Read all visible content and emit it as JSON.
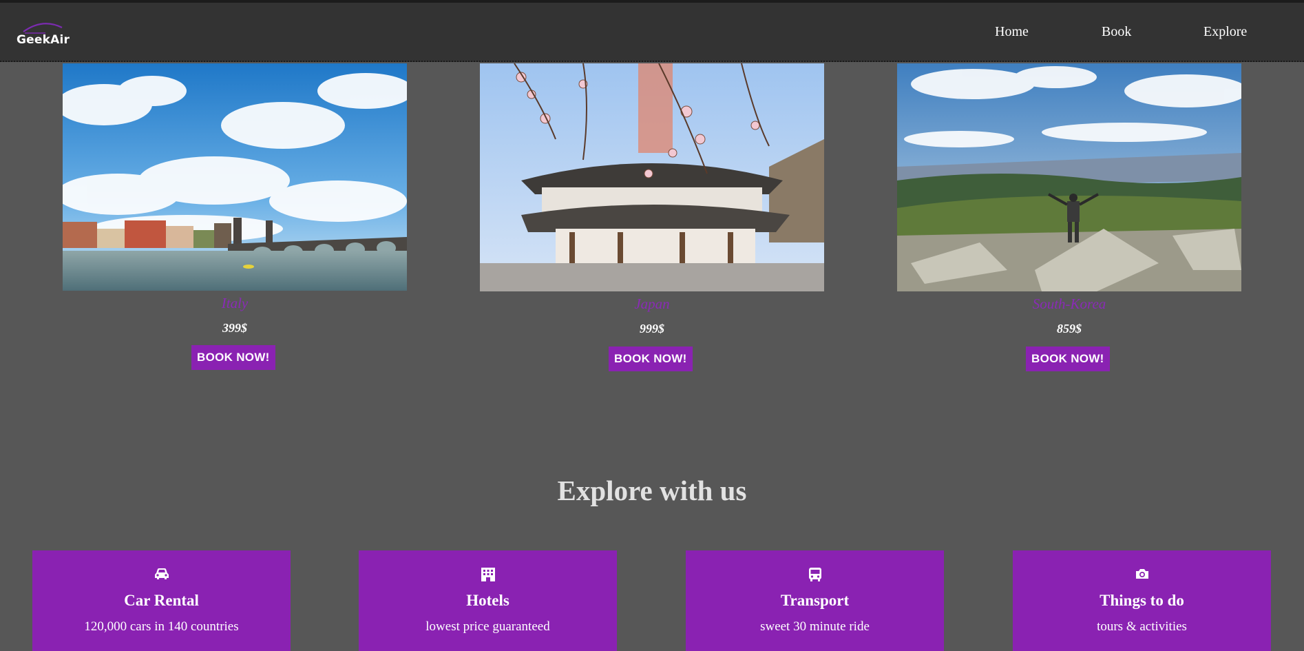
{
  "brand": {
    "name": "GeekAir"
  },
  "nav": {
    "items": [
      "Home",
      "Book",
      "Explore"
    ]
  },
  "destinations": [
    {
      "name": "Italy",
      "price": "399$",
      "button": "BOOK NOW!"
    },
    {
      "name": "Japan",
      "price": "999$",
      "button": "BOOK NOW!"
    },
    {
      "name": "South-Korea",
      "price": "859$",
      "button": "BOOK NOW!"
    }
  ],
  "explore": {
    "title": "Explore with us",
    "cards": [
      {
        "icon": "car-icon",
        "title": "Car Rental",
        "subtitle": "120,000 cars in 140 countries"
      },
      {
        "icon": "building-icon",
        "title": "Hotels",
        "subtitle": "lowest price guaranteed"
      },
      {
        "icon": "bus-icon",
        "title": "Transport",
        "subtitle": "sweet 30 minute ride"
      },
      {
        "icon": "camera-icon",
        "title": "Things to do",
        "subtitle": "tours & activities"
      }
    ]
  },
  "colors": {
    "accent": "#8a22b2",
    "navbar": "#333333",
    "background": "#575757",
    "title_text": "#e2e2e2"
  }
}
